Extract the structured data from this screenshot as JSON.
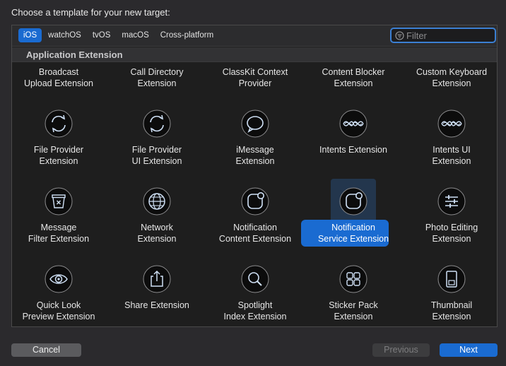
{
  "header": {
    "prompt": "Choose a template for your new target:"
  },
  "platform_tabs": [
    {
      "label": "iOS",
      "selected": true
    },
    {
      "label": "watchOS",
      "selected": false
    },
    {
      "label": "tvOS",
      "selected": false
    },
    {
      "label": "macOS",
      "selected": false
    },
    {
      "label": "Cross-platform",
      "selected": false
    }
  ],
  "filter": {
    "placeholder": "Filter",
    "value": ""
  },
  "section": {
    "title": "Application Extension"
  },
  "templates": [
    {
      "label": "Broadcast\nUpload Extension",
      "icon": ""
    },
    {
      "label": "Call Directory\nExtension",
      "icon": ""
    },
    {
      "label": "ClassKit Context\nProvider",
      "icon": ""
    },
    {
      "label": "Content Blocker\nExtension",
      "icon": ""
    },
    {
      "label": "Custom Keyboard\nExtension",
      "icon": ""
    },
    {
      "label": "File Provider\nExtension",
      "icon": "refresh-icon"
    },
    {
      "label": "File Provider\nUI Extension",
      "icon": "refresh-icon"
    },
    {
      "label": "iMessage\nExtension",
      "icon": "message-bubble-icon"
    },
    {
      "label": "Intents Extension",
      "icon": "siri-wave-icon"
    },
    {
      "label": "Intents UI\nExtension",
      "icon": "siri-wave-icon"
    },
    {
      "label": "Message\nFilter Extension",
      "icon": "filter-tray-icon"
    },
    {
      "label": "Network\nExtension",
      "icon": "globe-icon"
    },
    {
      "label": "Notification\nContent Extension",
      "icon": "notification-icon"
    },
    {
      "label": "Notification\nService Extension",
      "icon": "notification-icon",
      "selected": true
    },
    {
      "label": "Photo Editing\nExtension",
      "icon": "sliders-icon"
    },
    {
      "label": "Quick Look\nPreview Extension",
      "icon": "eye-icon"
    },
    {
      "label": "Share Extension",
      "icon": "share-icon"
    },
    {
      "label": "Spotlight\nIndex Extension",
      "icon": "magnifier-icon"
    },
    {
      "label": "Sticker Pack\nExtension",
      "icon": "sticker-grid-icon"
    },
    {
      "label": "Thumbnail\nExtension",
      "icon": "thumbnail-icon"
    }
  ],
  "buttons": {
    "cancel": "Cancel",
    "previous": "Previous",
    "next": "Next"
  },
  "colors": {
    "accent": "#1a6bd1",
    "icon_stroke": "#cfe0f5",
    "icon_fill": "#0c0c0c"
  }
}
